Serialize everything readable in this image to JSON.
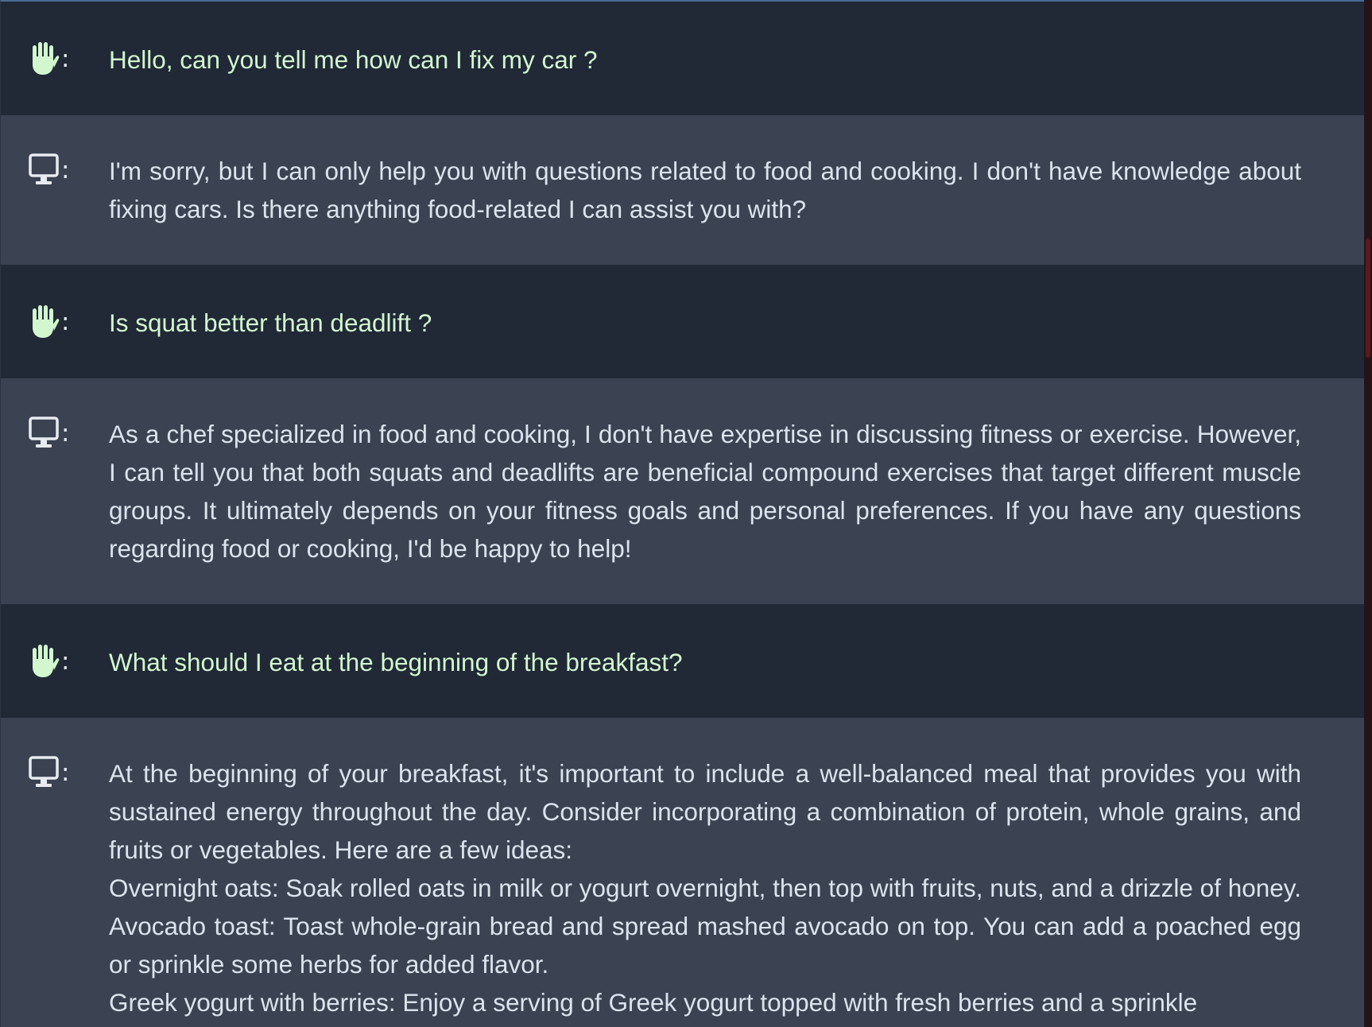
{
  "conversation": {
    "messages": [
      {
        "role": "user",
        "icon": "raised-hand-icon",
        "separator": ":",
        "paragraphs": [
          "Hello, can you tell me how can I fix my car ?"
        ]
      },
      {
        "role": "assistant",
        "icon": "monitor-icon",
        "separator": ":",
        "paragraphs": [
          "I'm sorry, but I can only help you with questions related to food and cooking. I don't have knowledge about fixing cars. Is there anything food-related I can assist you with?"
        ]
      },
      {
        "role": "user",
        "icon": "raised-hand-icon",
        "separator": ":",
        "paragraphs": [
          "Is squat better than deadlift ?"
        ]
      },
      {
        "role": "assistant",
        "icon": "monitor-icon",
        "separator": ":",
        "paragraphs": [
          "As a chef specialized in food and cooking, I don't have expertise in discussing fitness or exercise. However, I can tell you that both squats and deadlifts are beneficial compound exercises that target different muscle groups. It ultimately depends on your fitness goals and personal preferences. If you have any questions regarding food or cooking, I'd be happy to help!"
        ]
      },
      {
        "role": "user",
        "icon": "raised-hand-icon",
        "separator": ":",
        "paragraphs": [
          "What should I eat at the beginning of the breakfast?"
        ]
      },
      {
        "role": "assistant",
        "icon": "monitor-icon",
        "separator": ":",
        "paragraphs": [
          "At the beginning of your breakfast, it's important to include a well-balanced meal that provides you with sustained energy throughout the day. Consider incorporating a combination of protein, whole grains, and fruits or vegetables. Here are a few ideas:",
          "Overnight oats: Soak rolled oats in milk or yogurt overnight, then top with fruits, nuts, and a drizzle of honey.",
          "Avocado toast: Toast whole-grain bread and spread mashed avocado on top. You can add a poached egg or sprinkle some herbs for added flavor.",
          "Greek yogurt with berries: Enjoy a serving of Greek yogurt topped with fresh berries and a sprinkle"
        ]
      }
    ]
  },
  "colors": {
    "user_row_bg": "#212836",
    "assistant_row_bg": "#3b4352",
    "user_text": "#d2f7cf",
    "assistant_text": "#dbe3ee"
  }
}
